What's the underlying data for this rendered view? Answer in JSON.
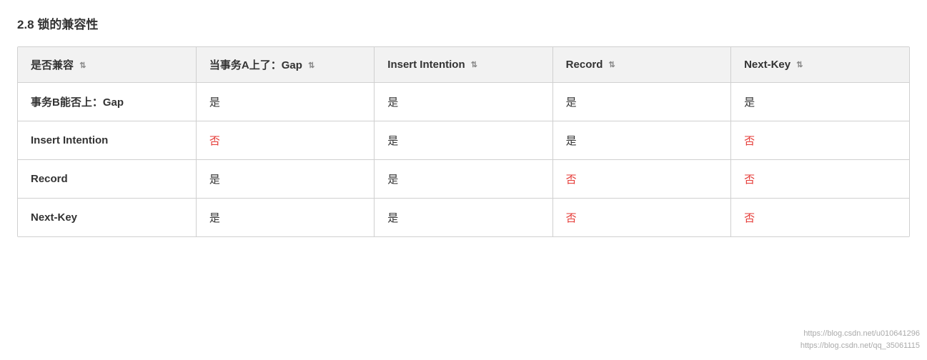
{
  "page": {
    "title": "2.8 锁的兼容性"
  },
  "table": {
    "headers": [
      {
        "label": "是否兼容",
        "has_sort": true
      },
      {
        "label": "当事务A上了：Gap",
        "has_sort": true
      },
      {
        "label": "Insert Intention",
        "has_sort": true
      },
      {
        "label": "Record",
        "has_sort": true
      },
      {
        "label": "Next-Key",
        "has_sort": true
      }
    ],
    "rows": [
      {
        "row_label": "事务B能否上：Gap",
        "col1": {
          "text": "是",
          "type": "yes"
        },
        "col2": {
          "text": "是",
          "type": "yes"
        },
        "col3": {
          "text": "是",
          "type": "yes"
        },
        "col4": {
          "text": "是",
          "type": "yes"
        }
      },
      {
        "row_label": "Insert Intention",
        "col1": {
          "text": "否",
          "type": "no"
        },
        "col2": {
          "text": "是",
          "type": "yes"
        },
        "col3": {
          "text": "是",
          "type": "yes"
        },
        "col4": {
          "text": "否",
          "type": "no"
        }
      },
      {
        "row_label": "Record",
        "col1": {
          "text": "是",
          "type": "yes"
        },
        "col2": {
          "text": "是",
          "type": "yes"
        },
        "col3": {
          "text": "否",
          "type": "no"
        },
        "col4": {
          "text": "否",
          "type": "no"
        }
      },
      {
        "row_label": "Next-Key",
        "col1": {
          "text": "是",
          "type": "yes"
        },
        "col2": {
          "text": "是",
          "type": "yes"
        },
        "col3": {
          "text": "否",
          "type": "no"
        },
        "col4": {
          "text": "否",
          "type": "no"
        }
      }
    ],
    "sort_icon": "⇅",
    "watermark_line1": "https://blog.csdn.net/u010641296",
    "watermark_line2": "https://blog.csdn.net/qq_35061115"
  }
}
